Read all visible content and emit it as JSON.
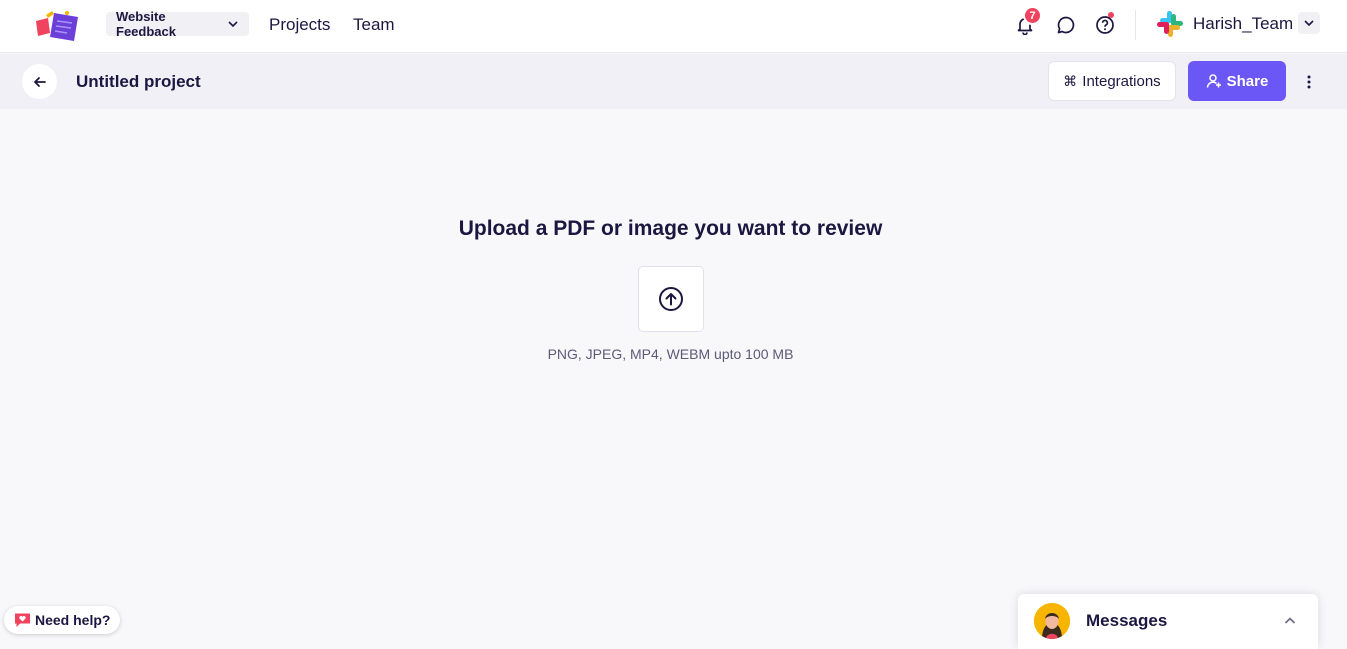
{
  "header": {
    "workspace_label": "Website Feedback",
    "nav": {
      "projects": "Projects",
      "team": "Team"
    },
    "notification_count": "7",
    "team_name": "Harish_Team"
  },
  "project_bar": {
    "title": "Untitled project",
    "integrations_label": "Integrations",
    "integrations_icon": "⌘",
    "share_label": "Share"
  },
  "upload": {
    "title": "Upload a PDF or image you want to review",
    "hint": "PNG, JPEG, MP4, WEBM upto 100 MB"
  },
  "footer": {
    "need_help_label": "Need help?",
    "messages_label": "Messages"
  },
  "colors": {
    "accent": "#6b57f5",
    "badge": "#f0435e",
    "text": "#1c1740"
  },
  "icons": [
    "app-logo",
    "chevron-down-icon",
    "bell-icon",
    "chat-bubble-icon",
    "help-circle-icon",
    "slack-logo",
    "arrow-left-icon",
    "command-icon",
    "add-user-icon",
    "kebab-icon",
    "upload-arrow-icon",
    "heart-chat-icon",
    "chevron-up-icon"
  ]
}
